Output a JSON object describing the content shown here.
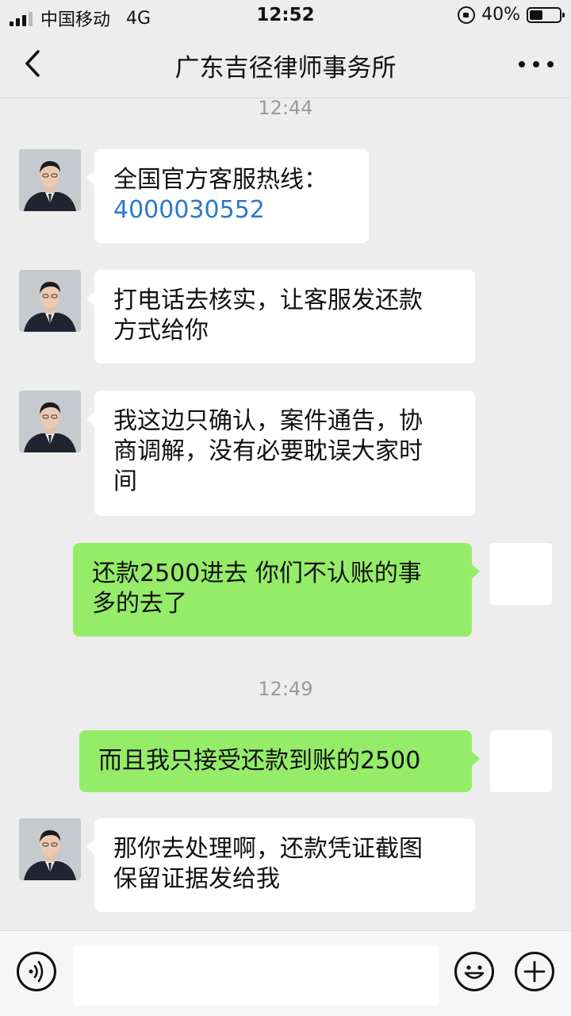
{
  "status_bar": {
    "carrier": "中国移动",
    "network": "4G",
    "time": "12:52",
    "battery": "40%",
    "battery_level": 0.4
  },
  "nav": {
    "title": "广东吉径律师事务所",
    "back_icon": "chevron-left-icon",
    "more_icon": "ellipsis-icon"
  },
  "chat": {
    "timestamps": [
      "12:44",
      "12:49"
    ],
    "messages": [
      {
        "from": "contact",
        "lines": [
          "全国官方客服热线：",
          "4000030552"
        ]
      },
      {
        "from": "contact",
        "lines": [
          "打电话去核实，让客服发还款",
          "方式给你"
        ]
      },
      {
        "from": "contact",
        "lines": [
          "我这边只确认，案件通告，协",
          "商调解，没有必要耽误大家时",
          "间"
        ]
      },
      {
        "from": "me",
        "lines": [
          "还款2500进去 你们不认账的事",
          "多的去了"
        ]
      },
      {
        "from": "me",
        "lines": [
          "而且我只接受还款到账的2500"
        ]
      },
      {
        "from": "contact",
        "lines": [
          "那你去处理啊，还款凭证截图",
          "保留证据发给我"
        ]
      }
    ]
  },
  "input_bar": {
    "voice_icon": "voice-icon",
    "emoji_icon": "emoji-icon",
    "plus_icon": "plus-icon",
    "text_value": ""
  },
  "colors": {
    "background": "#ededed",
    "outgoing_bubble": "#95ec69",
    "incoming_bubble": "#ffffff",
    "link": "#2c78c7"
  }
}
